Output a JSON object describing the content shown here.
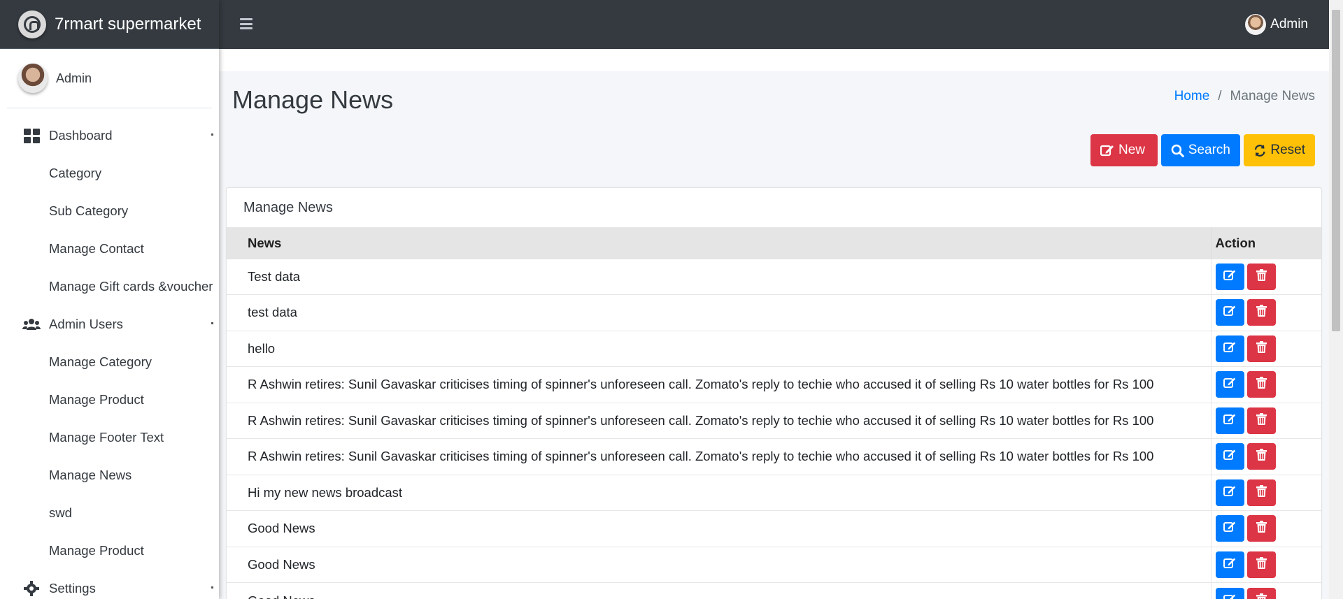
{
  "brand": {
    "name": "7rmart supermarket"
  },
  "sidebar_user": {
    "name": "Admin"
  },
  "topbar": {
    "user_name": "Admin"
  },
  "sidebar": {
    "items": [
      {
        "label": "Dashboard",
        "type": "top",
        "icon": "dashboard-icon",
        "expandable": true
      },
      {
        "label": "Category",
        "type": "sub"
      },
      {
        "label": "Sub Category",
        "type": "sub"
      },
      {
        "label": "Manage Contact",
        "type": "sub"
      },
      {
        "label": "Manage Gift cards &voucher",
        "type": "sub"
      },
      {
        "label": "Admin Users",
        "type": "top",
        "icon": "users-icon",
        "expandable": true
      },
      {
        "label": "Manage Category",
        "type": "sub"
      },
      {
        "label": "Manage Product",
        "type": "sub"
      },
      {
        "label": "Manage Footer Text",
        "type": "sub"
      },
      {
        "label": "Manage News",
        "type": "sub"
      },
      {
        "label": "swd",
        "type": "sub"
      },
      {
        "label": "Manage Product",
        "type": "sub"
      },
      {
        "label": "Settings",
        "type": "top",
        "icon": "gear-icon",
        "expandable": true
      }
    ]
  },
  "page": {
    "title": "Manage News",
    "breadcrumb": {
      "home": "Home",
      "separator": "/",
      "current": "Manage News"
    }
  },
  "toolbar": {
    "new_label": "New",
    "search_label": "Search",
    "reset_label": "Reset"
  },
  "card": {
    "title": "Manage News",
    "columns": {
      "news": "News",
      "action": "Action"
    },
    "rows": [
      "Test data",
      "test data",
      "hello",
      "R Ashwin retires: Sunil Gavaskar criticises timing of spinner's unforeseen call. Zomato's reply to techie who accused it of selling Rs 10 water bottles for Rs 100",
      "R Ashwin retires: Sunil Gavaskar criticises timing of spinner's unforeseen call. Zomato's reply to techie who accused it of selling Rs 10 water bottles for Rs 100",
      "R Ashwin retires: Sunil Gavaskar criticises timing of spinner's unforeseen call. Zomato's reply to techie who accused it of selling Rs 10 water bottles for Rs 100",
      "Hi my new news broadcast",
      "Good News",
      "Good News",
      "Good News"
    ]
  },
  "colors": {
    "topbar": "#343a40",
    "primary": "#007bff",
    "danger": "#dc3545",
    "warning": "#ffc107",
    "content_bg": "#f4f6f9"
  }
}
